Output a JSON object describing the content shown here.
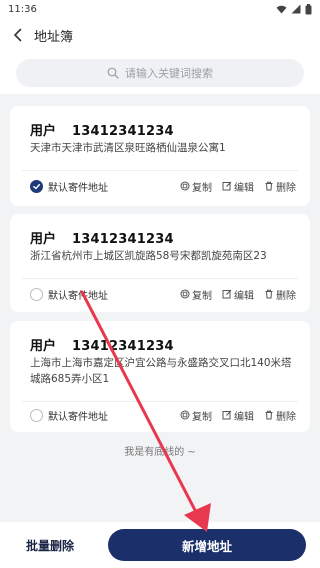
{
  "status_bar": {
    "time": "11:36"
  },
  "header": {
    "title": "地址簿"
  },
  "search": {
    "placeholder": "请输入关键词搜索"
  },
  "addresses": [
    {
      "name": "用户",
      "phone": "13412341234",
      "address": "天津市天津市武清区泉旺路栖仙温泉公寓1",
      "default_label": "默认寄件地址",
      "is_default": true
    },
    {
      "name": "用户",
      "phone": "13412341234",
      "address": "浙江省杭州市上城区凯旋路58号宋都凯旋苑南区23",
      "default_label": "默认寄件地址",
      "is_default": false
    },
    {
      "name": "用户",
      "phone": "13412341234",
      "address": "上海市上海市嘉定区沪宜公路与永盛路交叉口北140米塔城路685弄小区1",
      "default_label": "默认寄件地址",
      "is_default": false
    }
  ],
  "card_actions": {
    "copy": "复制",
    "edit": "编辑",
    "delete": "删除"
  },
  "list_footer": "我是有底线的 ~",
  "bottom_bar": {
    "batch_delete": "批量删除",
    "add_address": "新增地址"
  },
  "colors": {
    "primary": "#1b2f6a",
    "annotation_arrow": "#e8384f"
  }
}
